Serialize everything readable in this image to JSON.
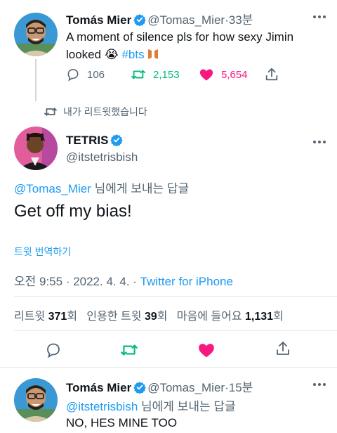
{
  "tweet1": {
    "name": "Tomás Mier",
    "handle": "@Tomas_Mier",
    "separator": "·",
    "time": "33분",
    "text_main": "A moment of silence pls for how sexy Jimin looked",
    "emoji": "😭",
    "hashtag": "#bts",
    "replies": "106",
    "retweets": "2,153",
    "likes": "5,654"
  },
  "retweet_notice": "내가 리트윗했습니다",
  "main_tweet": {
    "name": "TETRIS",
    "handle": "@itstetrisbish",
    "reply_to_handle": "@Tomas_Mier",
    "reply_to_suffix": "님에게 보내는 답글",
    "text": "Get off my bias!",
    "translate": "트윗 번역하기",
    "timestamp": "오전 9:55 · 2022. 4. 4. · ",
    "source": "Twitter for iPhone",
    "stats": {
      "retweets_label": "리트윗",
      "retweets_value": "371",
      "retweets_unit": "회",
      "quotes_label": "인용한 트윗",
      "quotes_value": "39",
      "quotes_unit": "회",
      "likes_label": "마음에 들어요",
      "likes_value": "1,131",
      "likes_unit": "회"
    }
  },
  "tweet3": {
    "name": "Tomás Mier",
    "handle": "@Tomas_Mier",
    "separator": "·",
    "time": "15분",
    "reply_to_handle": "@itstetrisbish",
    "reply_to_suffix": "님에게 보내는 답글",
    "text": "NO, HES MINE TOO"
  },
  "colors": {
    "accent": "#1d9bf0",
    "retweet": "#00ba7c",
    "like": "#f91880",
    "muted": "#536471"
  }
}
